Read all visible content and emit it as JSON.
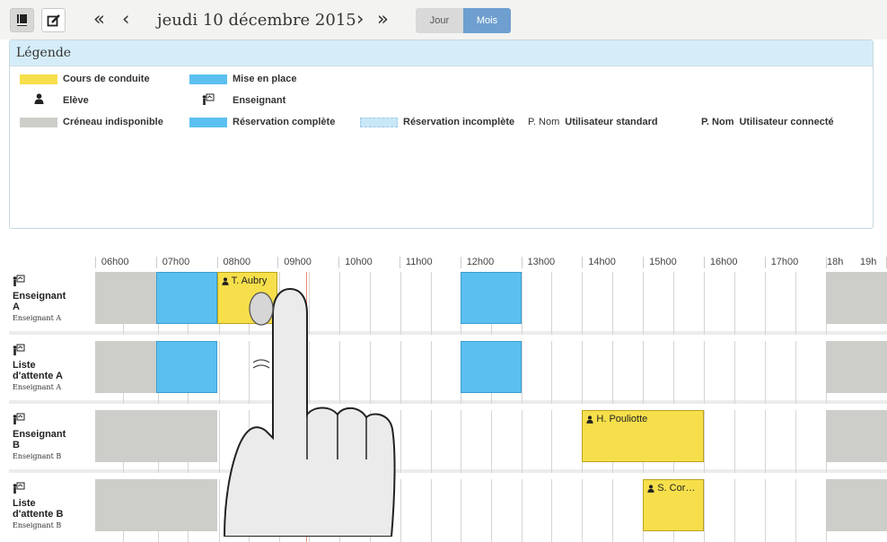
{
  "toolbar": {
    "date": "jeudi 10 décembre 2015",
    "first_label": "«",
    "prev_label": "‹",
    "next_label": "›",
    "last_label": "»",
    "view_day": "Jour",
    "view_month": "Mois",
    "accent": "#6e9fcf"
  },
  "legend": {
    "title": "Légende",
    "items": [
      {
        "label": "Cours de conduite",
        "color": "#f6df4b"
      },
      {
        "label": "Mise en place",
        "color": "#5bc0f0"
      },
      {
        "label": "Elève",
        "icon": "student-icon"
      },
      {
        "label": "Enseignant",
        "icon": "teacher-icon"
      },
      {
        "label": "Créneau indisponible",
        "color": "#cdcdca"
      },
      {
        "label": "Réservation complète",
        "color": "#5bc0f0"
      },
      {
        "label": "Réservation incomplète",
        "color": "#c8e7f7"
      },
      {
        "prefix": "P. Nom",
        "label": "Utilisateur standard"
      },
      {
        "prefix": "P. Nom",
        "label": "Utilisateur connecté"
      }
    ]
  },
  "timeline": {
    "hours": [
      "06h00",
      "07h00",
      "08h00",
      "09h00",
      "10h00",
      "11h00",
      "12h00",
      "13h00",
      "14h00",
      "15h00",
      "16h00",
      "17h00",
      "18h",
      "19h"
    ],
    "rows": [
      {
        "name": "Enseignant A",
        "subtitle": "Enseignant A",
        "blocks": [
          {
            "type": "indisponible",
            "start": 5.5,
            "end": 6.5
          },
          {
            "type": "mise",
            "start": 6.5,
            "end": 7.5
          },
          {
            "type": "cours",
            "start": 7.5,
            "end": 8.5,
            "student": "T. Aubry"
          },
          {
            "type": "mise",
            "start": 11.5,
            "end": 12.5
          },
          {
            "type": "indisponible",
            "start": 17.5,
            "end": 18.6
          }
        ]
      },
      {
        "name": "Liste d'attente A",
        "subtitle": "Enseignant A",
        "blocks": [
          {
            "type": "indisponible",
            "start": 5.5,
            "end": 6.5
          },
          {
            "type": "mise",
            "start": 6.5,
            "end": 7.5
          },
          {
            "type": "mise",
            "start": 11.5,
            "end": 12.5
          },
          {
            "type": "indisponible",
            "start": 17.5,
            "end": 18.6
          }
        ]
      },
      {
        "name": "Enseignant B",
        "subtitle": "Enseignant B",
        "blocks": [
          {
            "type": "indisponible",
            "start": 5.5,
            "end": 7.5
          },
          {
            "type": "cours",
            "start": 13.5,
            "end": 15.5,
            "student": "H. Pouliotte"
          },
          {
            "type": "indisponible",
            "start": 17.5,
            "end": 18.6
          }
        ]
      },
      {
        "name": "Liste d'attente B",
        "subtitle": "Enseignant B",
        "blocks": [
          {
            "type": "indisponible",
            "start": 5.5,
            "end": 7.5
          },
          {
            "type": "cours",
            "start": 14.5,
            "end": 15.5,
            "student": "S. Cor…"
          },
          {
            "type": "indisponible",
            "start": 17.5,
            "end": 18.6
          }
        ]
      }
    ]
  }
}
